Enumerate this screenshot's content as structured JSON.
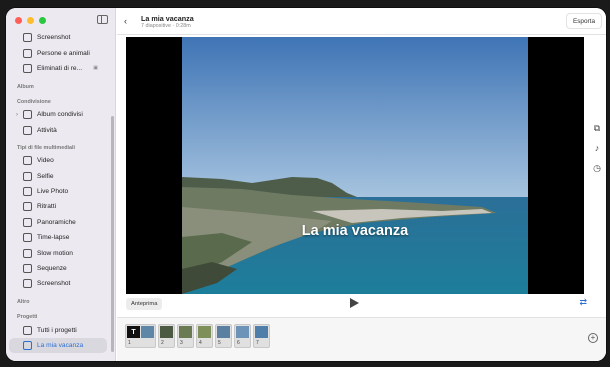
{
  "window": {
    "traffic_colors": [
      "#ff5f57",
      "#febc2e",
      "#28c840"
    ]
  },
  "sidebar": {
    "rows": [
      {
        "type": "item",
        "label": "Screenshot",
        "icon": "screenshot-icon"
      },
      {
        "type": "item",
        "label": "Persone e animali",
        "icon": "person-icon"
      },
      {
        "type": "item",
        "label": "Eliminati di re...",
        "icon": "trash-icon",
        "lock": true
      },
      {
        "type": "header",
        "label": "Album"
      },
      {
        "type": "header",
        "label": "Condivisione"
      },
      {
        "type": "item",
        "label": "Album condivisi",
        "icon": "shared-album-icon",
        "chevron": true
      },
      {
        "type": "item",
        "label": "Attività",
        "icon": "activity-icon"
      },
      {
        "type": "header",
        "label": "Tipi di file multimediali"
      },
      {
        "type": "item",
        "label": "Video",
        "icon": "video-icon"
      },
      {
        "type": "item",
        "label": "Selfie",
        "icon": "selfie-icon"
      },
      {
        "type": "item",
        "label": "Live Photo",
        "icon": "live-photo-icon"
      },
      {
        "type": "item",
        "label": "Ritratti",
        "icon": "portrait-icon"
      },
      {
        "type": "item",
        "label": "Panoramiche",
        "icon": "panorama-icon"
      },
      {
        "type": "item",
        "label": "Time-lapse",
        "icon": "timelapse-icon"
      },
      {
        "type": "item",
        "label": "Slow motion",
        "icon": "slowmo-icon"
      },
      {
        "type": "item",
        "label": "Sequenze",
        "icon": "burst-icon"
      },
      {
        "type": "item",
        "label": "Screenshot",
        "icon": "screenshot-icon"
      },
      {
        "type": "header",
        "label": "Altro"
      },
      {
        "type": "header",
        "label": "Progetti"
      },
      {
        "type": "item",
        "label": "Tutti i progetti",
        "icon": "projects-icon"
      },
      {
        "type": "item",
        "label": "La mia vacanza",
        "icon": "slideshow-icon",
        "selected": true
      }
    ]
  },
  "header": {
    "title": "La mia vacanza",
    "subtitle": "7 diapositive · 0:28m",
    "export_label": "Esporta"
  },
  "slide": {
    "overlay_title": "La mia vacanza"
  },
  "controls": {
    "preview_label": "Anteprima"
  },
  "filmstrip": {
    "thumbs": [
      {
        "num": "1",
        "cells": [
          "#111111",
          "#5f86a6"
        ],
        "text_slide": true
      },
      {
        "num": "2",
        "cells": [
          "#4c5a43"
        ]
      },
      {
        "num": "3",
        "cells": [
          "#6a7a52"
        ]
      },
      {
        "num": "4",
        "cells": [
          "#7f8f5a"
        ]
      },
      {
        "num": "5",
        "cells": [
          "#5a7fa0"
        ]
      },
      {
        "num": "6",
        "cells": [
          "#6d93b8"
        ]
      },
      {
        "num": "7",
        "cells": [
          "#4f7ea8"
        ]
      }
    ]
  },
  "colors": {
    "accent": "#2a6fd6"
  }
}
